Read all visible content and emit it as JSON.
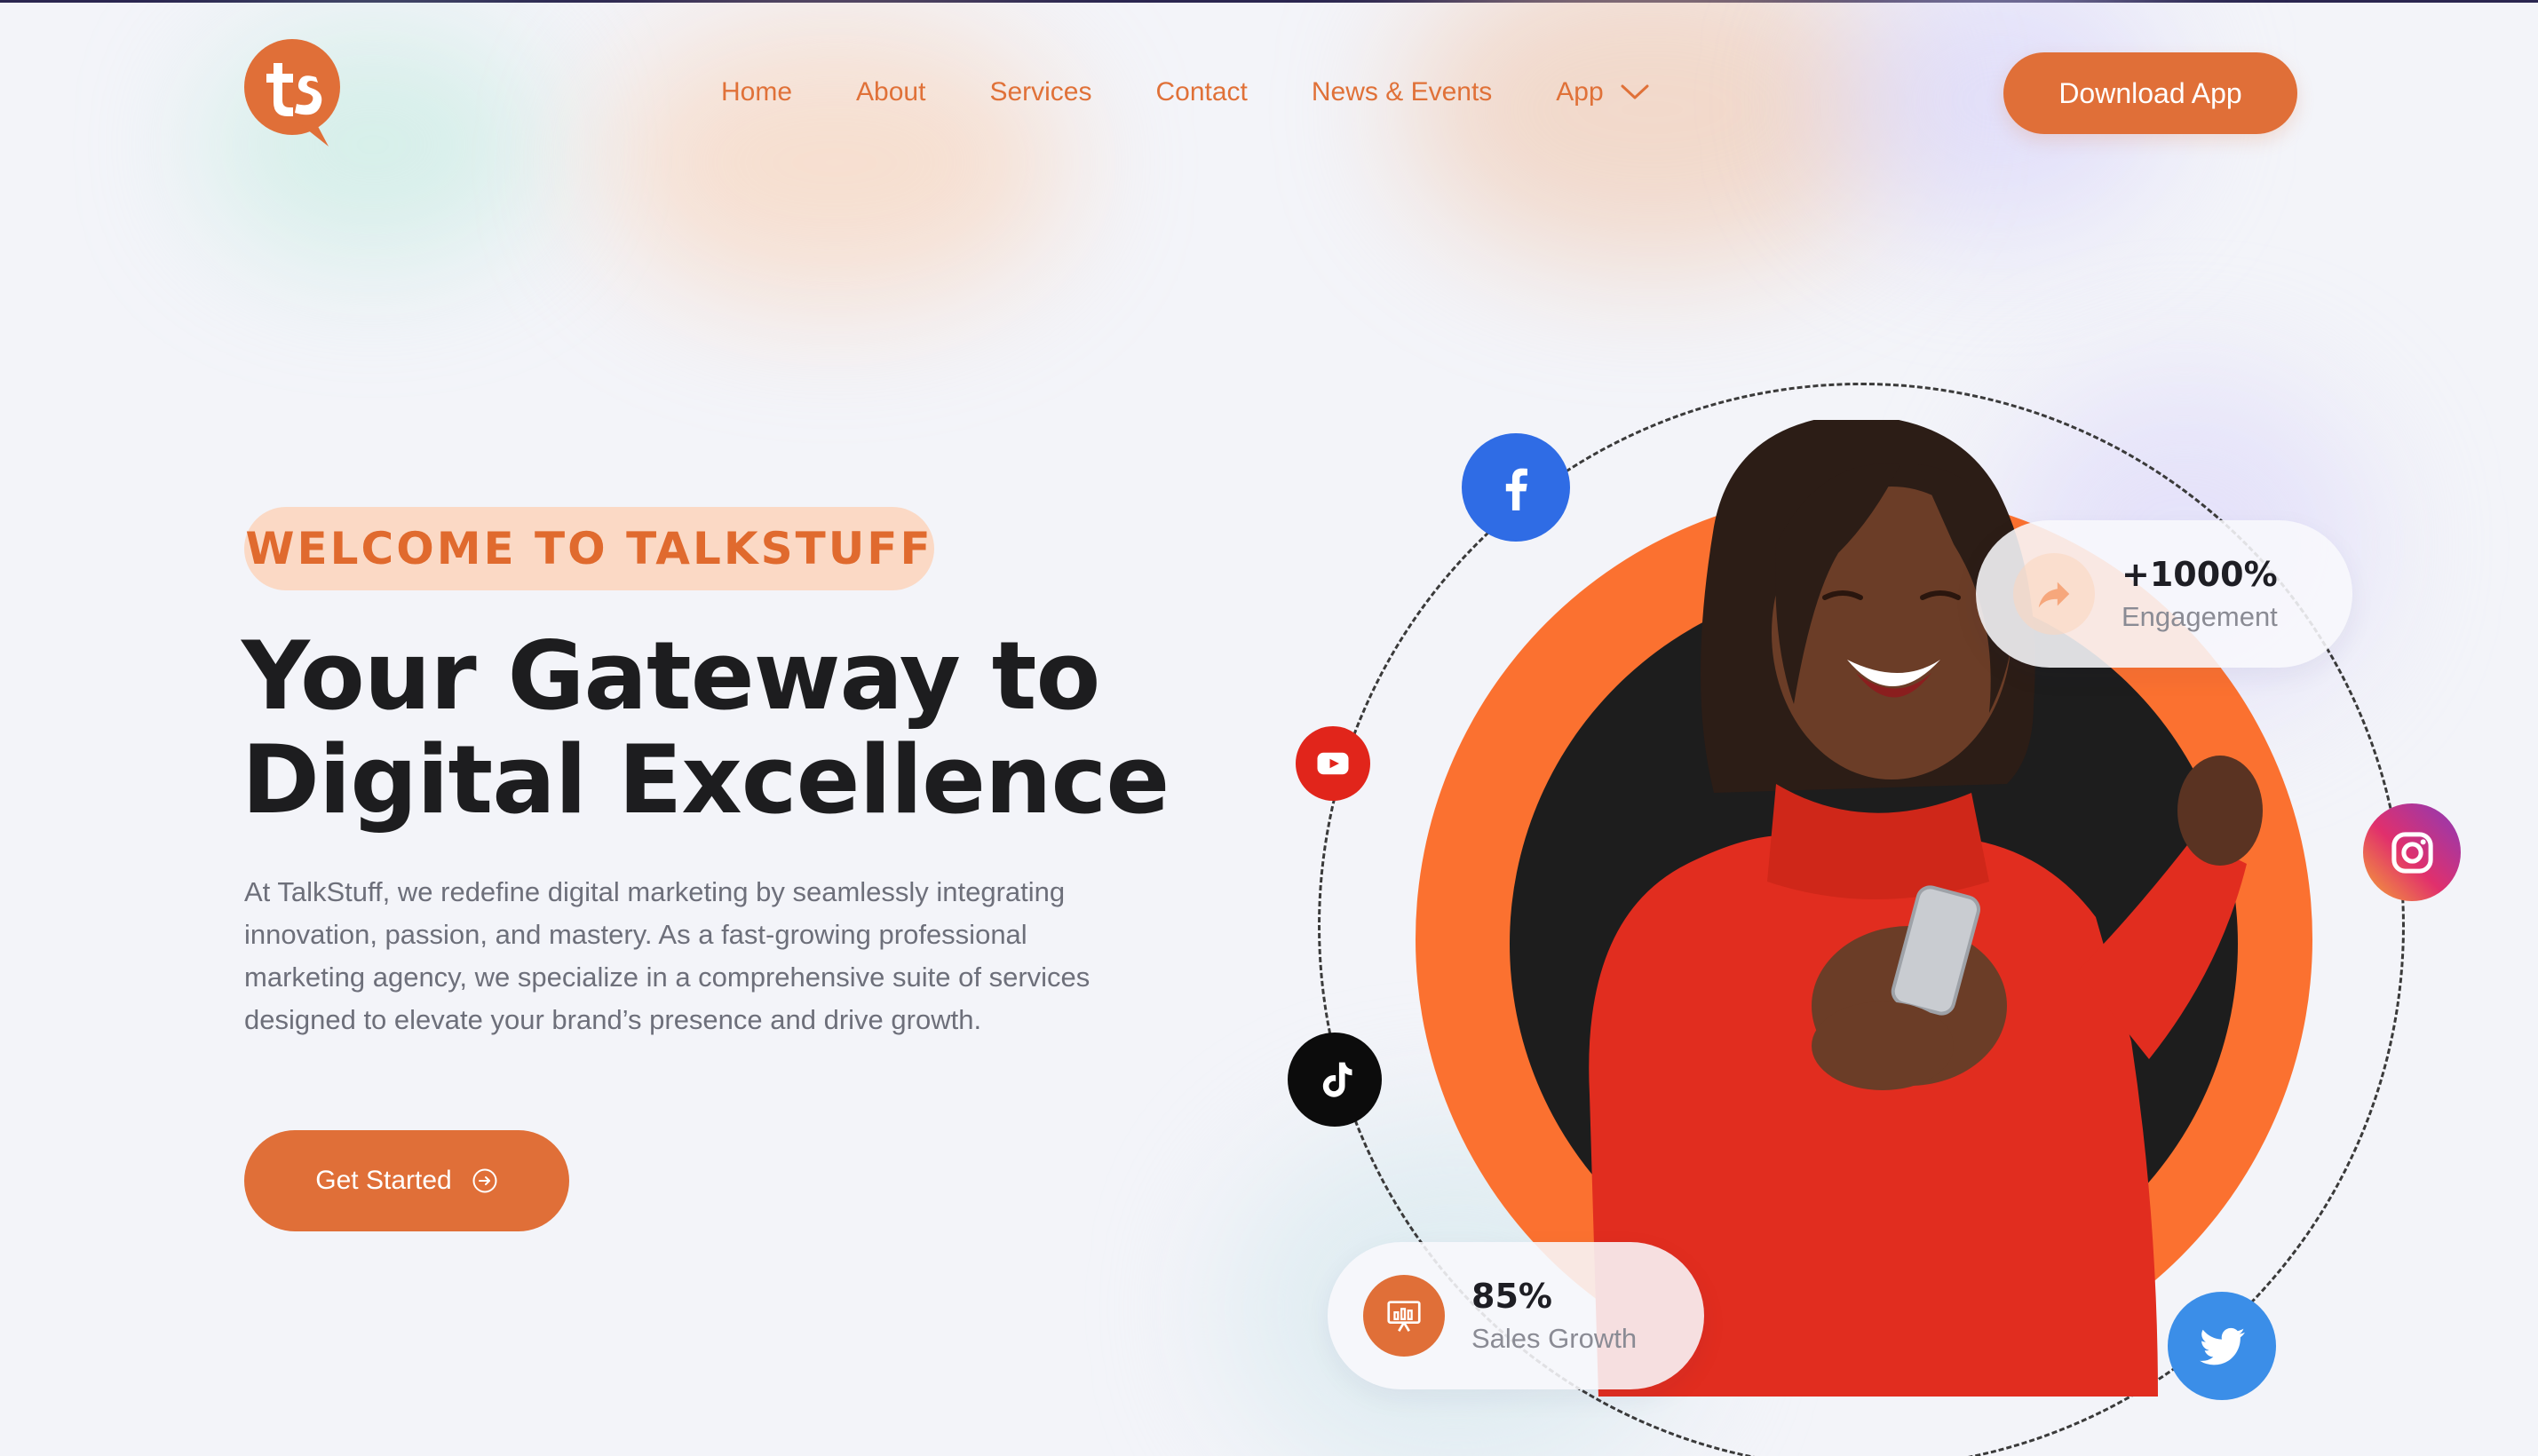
{
  "header": {
    "logo_icon": "talkstuff-logo-icon",
    "nav": [
      {
        "label": "Home"
      },
      {
        "label": "About"
      },
      {
        "label": "Services"
      },
      {
        "label": "Contact"
      },
      {
        "label": "News & Events"
      },
      {
        "label": "App",
        "icon": "chevron-down-icon"
      }
    ],
    "download_button": "Download App"
  },
  "hero": {
    "badge": "WELCOME TO TALKSTUFF",
    "headline_line1": "Your Gateway to",
    "headline_line2": "Digital Excellence",
    "description": "At TalkStuff, we redefine digital marketing by seamlessly integrating innovation, passion, and mastery. As a fast-growing professional marketing agency, we specialize in a comprehensive suite of services designed to elevate your brand’s presence and drive growth.",
    "cta": "Get Started",
    "cta_icon": "arrow-circle-right-icon"
  },
  "visual": {
    "social_icons": [
      "facebook-icon",
      "youtube-icon",
      "tiktok-icon",
      "instagram-icon",
      "twitter-icon"
    ],
    "stats": {
      "engagement": {
        "value": "+1000%",
        "label": "Engagement",
        "icon": "share-arrow-icon"
      },
      "sales": {
        "value": "85%",
        "label": "Sales Growth",
        "icon": "presentation-chart-icon"
      }
    }
  },
  "colors": {
    "accent": "#e06f38",
    "badge_bg": "#fbd9c5",
    "page_bg": "#f3f4f9",
    "orange_disc": "#fb7130",
    "facebook": "#2f6ce5",
    "youtube": "#e1251b",
    "twitter": "#3b8ee8"
  }
}
